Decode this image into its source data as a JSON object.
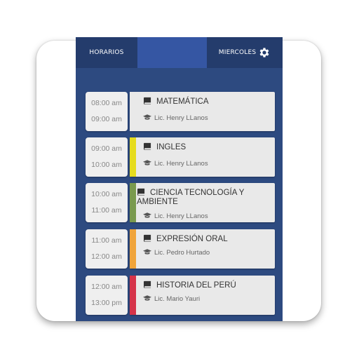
{
  "header": {
    "title": "HORARIOS",
    "day": "MIERCOLES",
    "settings_icon": "gear-icon"
  },
  "colors": {
    "background": "#2d4a80",
    "appbar": "#3556a3",
    "appbar_dark": "#243c6c"
  },
  "schedule": [
    {
      "start": "08:00 am",
      "end": "09:00 am",
      "course": "MATEMÁTICA",
      "teacher": "Lic. Henry LLanos",
      "accent": "#e9e9e9"
    },
    {
      "start": "09:00 am",
      "end": "10:00 am",
      "course": "INGLES",
      "teacher": "Lic. Henry LLanos",
      "accent": "#e6dc1e"
    },
    {
      "start": "10:00 am",
      "end": "11:00 am",
      "course": "CIENCIA TECNOLOGÍA Y AMBIENTE",
      "teacher": "Lic. Henry LLanos",
      "accent": "#7a9a4e"
    },
    {
      "start": "11:00 am",
      "end": "12:00 am",
      "course": "EXPRESIÓN ORAL",
      "teacher": "Lic. Pedro Hurtado",
      "accent": "#f0a43a"
    },
    {
      "start": "12:00 am",
      "end": "13:00 pm",
      "course": "HISTORIA DEL PERÚ",
      "teacher": "Lic. Mario Yauri",
      "accent": "#d6344a"
    }
  ]
}
